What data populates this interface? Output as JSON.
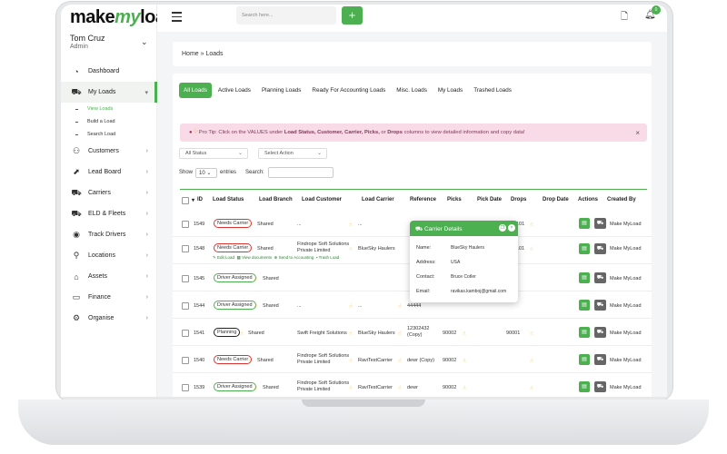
{
  "brand": {
    "logo_pre": "make",
    "logo_my": "my",
    "logo_post": "load"
  },
  "user": {
    "name": "Tom Cruz",
    "role": "Admin"
  },
  "nav": {
    "dashboard": "Dashboard",
    "my_loads": "My Loads",
    "sub": [
      "View Loads",
      "Build a Load",
      "Search Load"
    ],
    "items": [
      "Customers",
      "Lead Board",
      "Carriers",
      "ELD & Fleets",
      "Track Drivers",
      "Locations",
      "Assets",
      "Finance",
      "Organise"
    ]
  },
  "topbar": {
    "search_placeholder": "Search here...",
    "plus": "+",
    "notification_count": "0"
  },
  "breadcrumb": "Home » Loads",
  "tabs": [
    "All Loads",
    "Active Loads",
    "Planning Loads",
    "Ready For Accounting Loads",
    "Misc. Loads",
    "My Loads",
    "Trashed Loads"
  ],
  "tip": {
    "pre": "Pro Tip: Click on the VALUES under ",
    "bold1": "Load Status, Customer, Carrier, Picks,",
    "mid": " or ",
    "bold2": "Drops",
    "post": " columns to view detailed information and copy data!"
  },
  "filters": {
    "status": "All Status",
    "action": "Select Action"
  },
  "show": {
    "label": "Show",
    "count": "10",
    "entries": "entries",
    "search": "Search:"
  },
  "columns": [
    "ID",
    "Load Status",
    "Load Branch",
    "Load Customer",
    "Load Carrier",
    "Reference",
    "Picks",
    "Pick Date",
    "Drops",
    "Drop Date",
    "Actions",
    "Created By"
  ],
  "rows": [
    {
      "id": "1549",
      "status": "Needs Carrier",
      "branch": "Shared",
      "customer": "...",
      "carrier": "...",
      "reference": "",
      "picks": "",
      "drops": "",
      "by": "Make MyLoad"
    },
    {
      "id": "1548",
      "status": "Needs Carrier",
      "branch": "Shared",
      "customer": "Findrope Soft Solutions Private Limited",
      "carrier": "BlueSky Haulers",
      "reference": "",
      "picks": "",
      "drops": "",
      "by": "Make MyLoad"
    },
    {
      "id": "1545",
      "status": "Driver Assigned",
      "branch": "Shared",
      "customer": "",
      "carrier": "",
      "reference": "",
      "picks": "",
      "drops": "",
      "by": "Make MyLoad"
    },
    {
      "id": "1544",
      "status": "Driver Assigned",
      "branch": "Shared",
      "customer": "...",
      "carrier": "...",
      "reference": "44444",
      "picks": "",
      "drops": "",
      "by": "Make MyLoad"
    },
    {
      "id": "1541",
      "status": "Planning",
      "branch": "Shared",
      "customer": "Swift Freight Solutions",
      "carrier": "BlueSky Haulers",
      "reference": "12302432 (Copy)",
      "picks": "90002",
      "drops": "90001",
      "by": "Make MyLoad"
    },
    {
      "id": "1540",
      "status": "Needs Carrier",
      "branch": "Shared",
      "customer": "Findrope Soft Solutions Private Limited",
      "carrier": "RaviTestCarrier",
      "reference": "dewr (Copy)",
      "picks": "90002",
      "drops": "",
      "by": "Make MyLoad"
    },
    {
      "id": "1539",
      "status": "Driver Assigned",
      "branch": "Shared",
      "customer": "Findrope Soft Solutions Private Limited",
      "carrier": "RaviTestCarrier",
      "reference": "dewr",
      "picks": "90002",
      "drops": "",
      "by": "Make MyLoad"
    }
  ],
  "row_links": {
    "edit": "Edit Load",
    "docs": "View documents",
    "acct": "Send to Accounting",
    "trash": "Trash Load"
  },
  "partial_drops": {
    "r1": "101",
    "r2": "101"
  },
  "popup": {
    "title": "Carrier Details",
    "labels": [
      "Name:",
      "Address:",
      "Contact:",
      "Email:"
    ],
    "values": [
      "BlueSky Haulers",
      "USA",
      "Bruce Cotler",
      "ravikas.kamboj@gmail.com"
    ]
  },
  "colors": {
    "accent": "#4caf50",
    "tip_bg": "#f9dbe7",
    "needs_carrier": "#d33333"
  }
}
